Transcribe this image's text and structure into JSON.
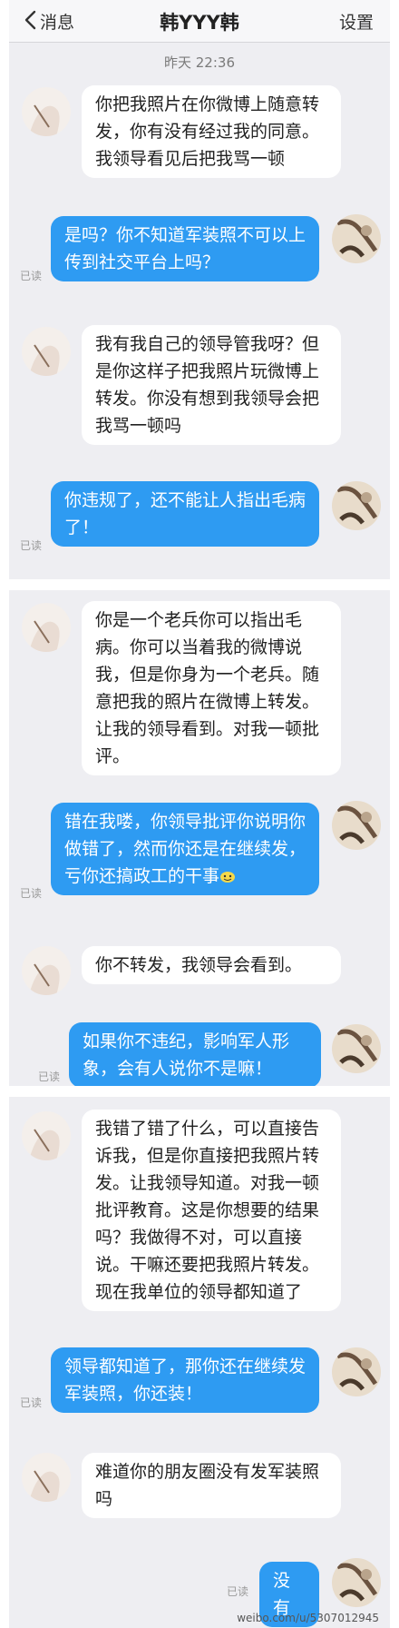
{
  "header": {
    "back_label": "消息",
    "title": "韩YYY韩",
    "settings_label": "设置"
  },
  "timestamp": "昨天 22:36",
  "read_label": "已读",
  "messages": [
    {
      "from": "them",
      "text": "你把我照片在你微博上随意转发，你有没有经过我的同意。我领导看见后把我骂一顿"
    },
    {
      "from": "me",
      "text": "是吗？你不知道军装照不可以上传到社交平台上吗？"
    },
    {
      "from": "them",
      "text": "我有我自己的领导管我呀？但是你这样子把我照片玩微博上转发。你没有想到我领导会把我骂一顿吗"
    },
    {
      "from": "me",
      "text": "你违规了，还不能让人指出毛病了！"
    },
    {
      "from": "them",
      "text": "你是一个老兵你可以指出毛病。你可以当着我的微博说我，但是你身为一个老兵。随意把我的照片在微博上转发。让我的领导看到。对我一顿批评。"
    },
    {
      "from": "me",
      "text": "错在我喽，你领导批评你说明你做错了，然而你还是在继续发，亏你还搞政工的干事"
    },
    {
      "from": "them",
      "text": "你不转发，我领导会看到。"
    },
    {
      "from": "me",
      "text": "如果你不违纪，影响军人形象，会有人说你不是嘛！"
    },
    {
      "from": "them",
      "text": "我错了错了什么，可以直接告诉我，但是你直接把我照片转发。让我领导知道。对我一顿批评教育。这是你想要的结果吗？我做得不对，可以直接说。干嘛还要把我照片转发。现在我单位的领导都知道了"
    },
    {
      "from": "me",
      "text": "领导都知道了，那你还在继续发军装照，你还装！"
    },
    {
      "from": "them",
      "text": "难道你的朋友圈没有发军装照吗"
    },
    {
      "from": "me",
      "text": "没有"
    }
  ],
  "watermark": "weibo.com/u/5307012945",
  "colors": {
    "outgoing_bubble": "#2e9bf2",
    "incoming_bubble": "#ffffff",
    "chat_background": "#eeeef2"
  }
}
